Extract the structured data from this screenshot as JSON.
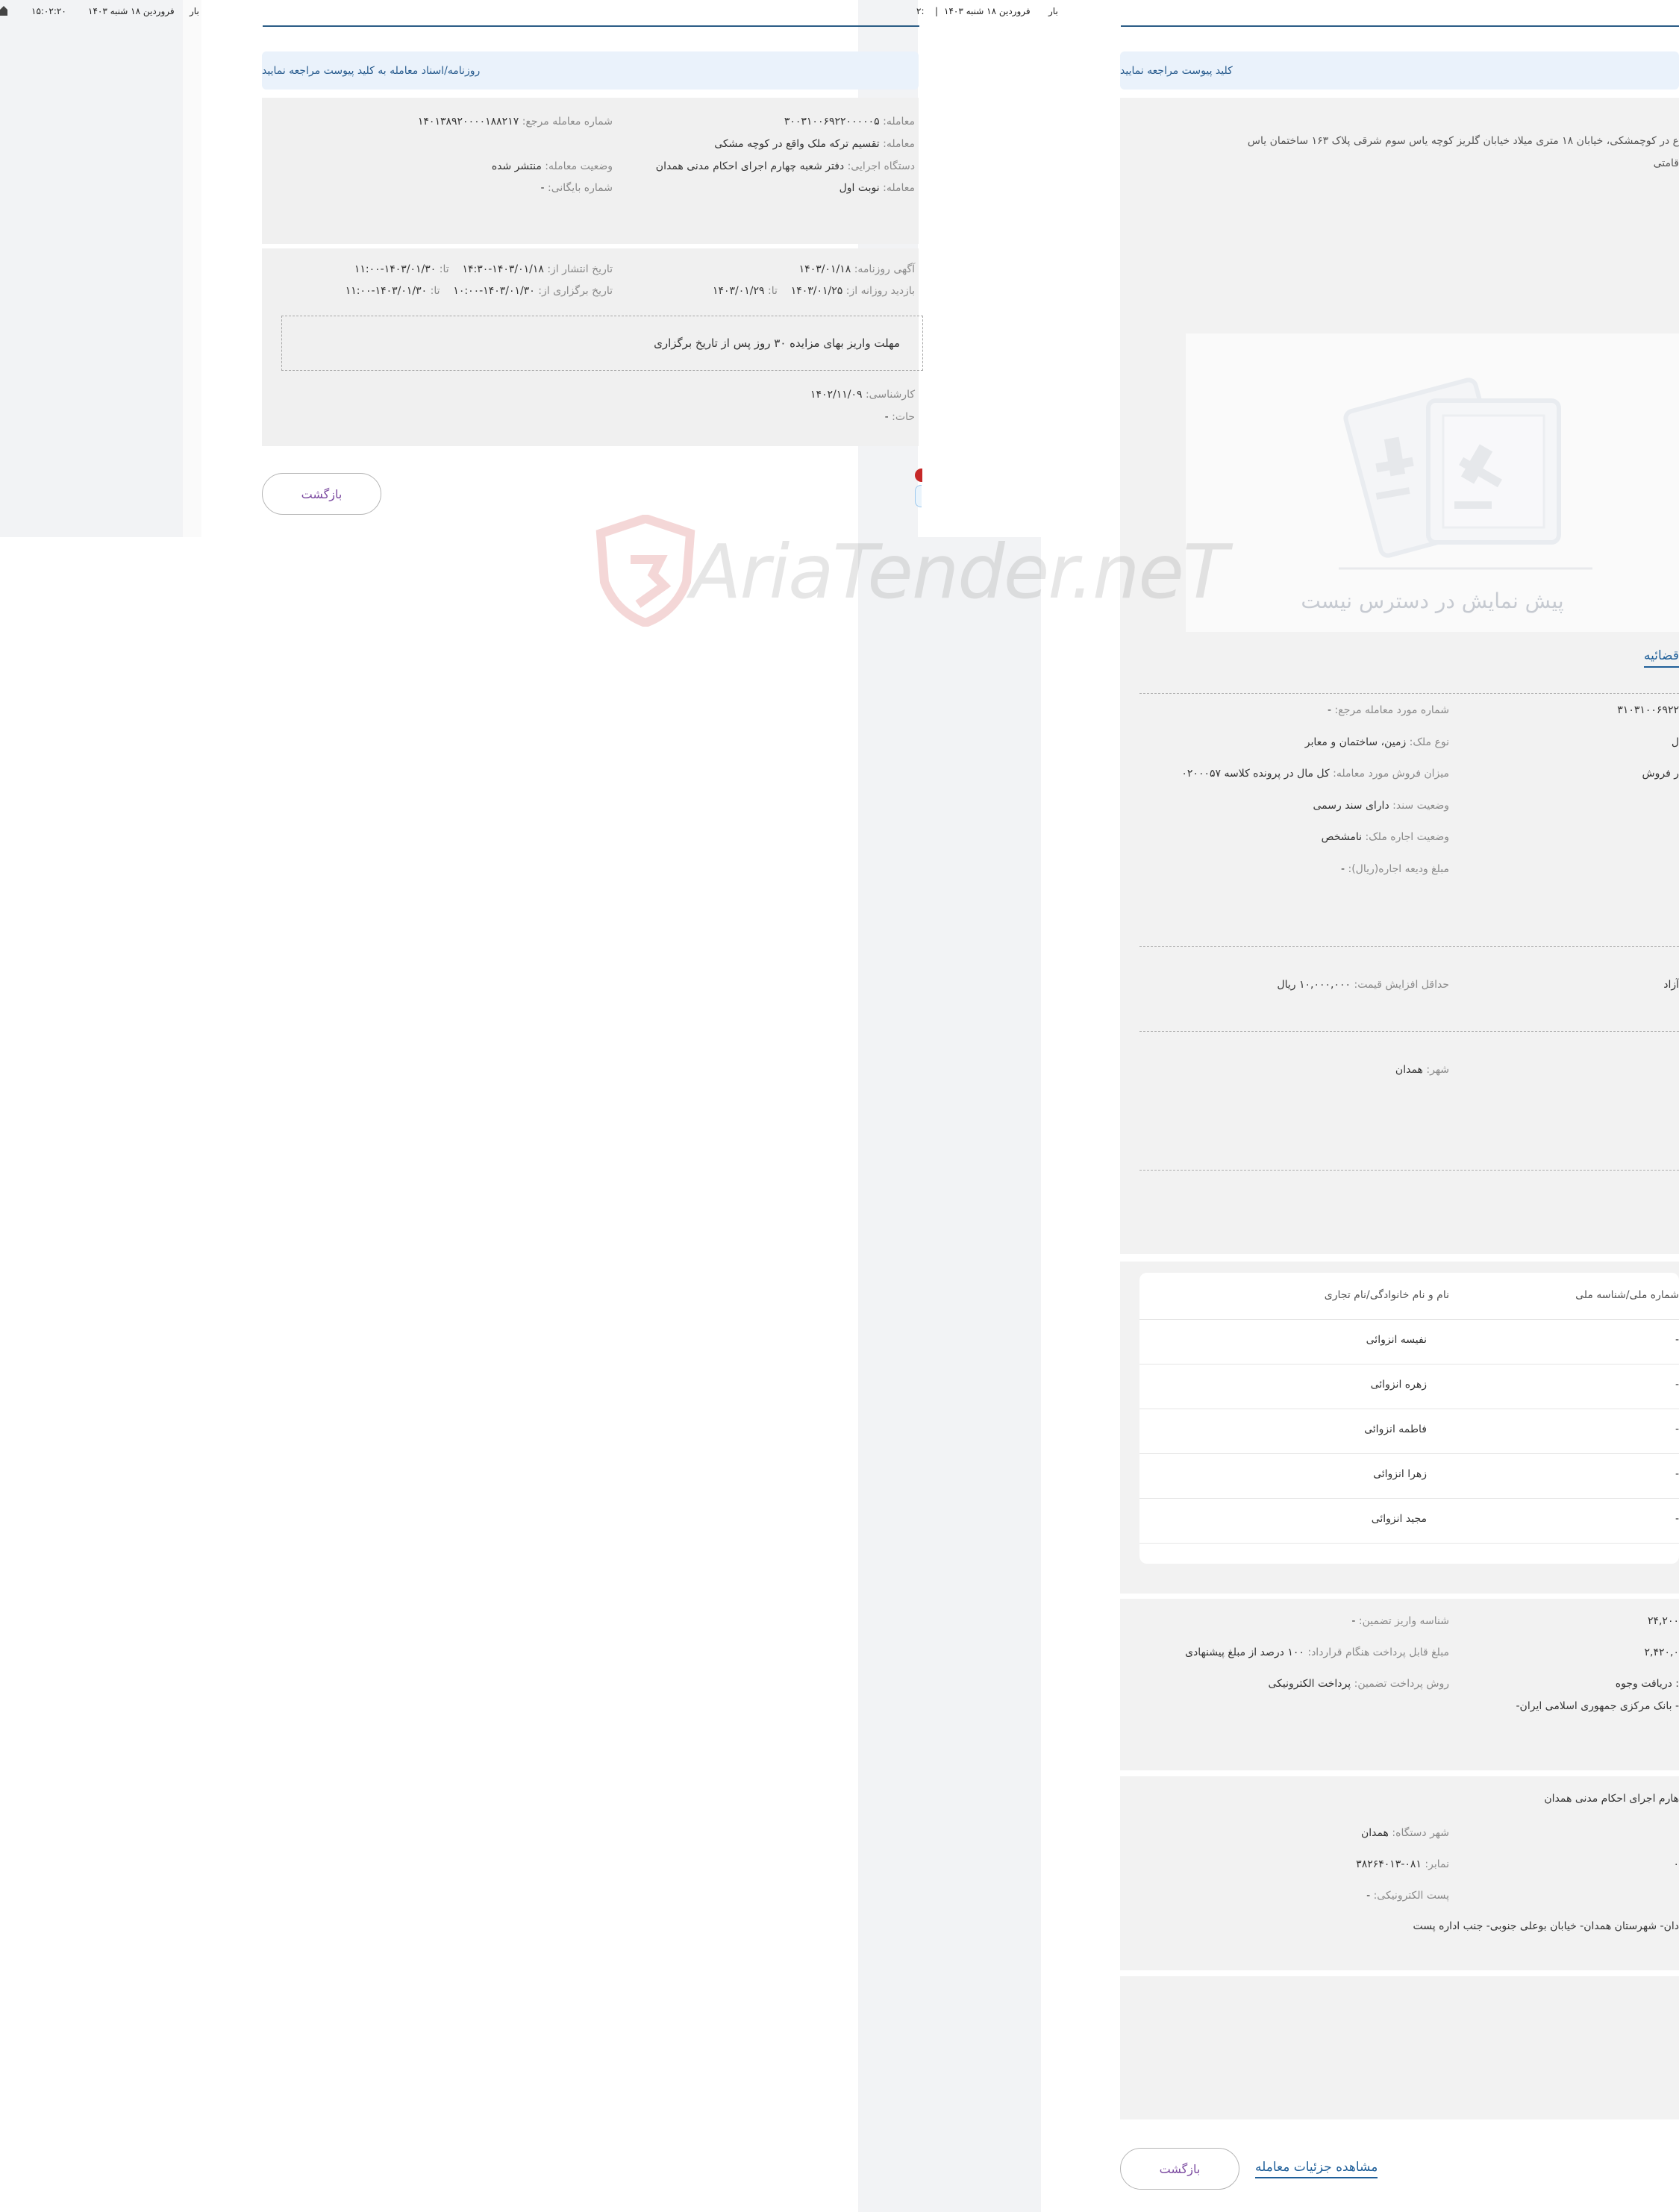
{
  "topbar_left": {
    "date": "فروردین ۱۸ شنبه ۱۴۰۳",
    "time": "۱۵:۰۲:۲۰",
    "cut": "بار"
  },
  "topbar_middle": {
    "date": "فروردین ۱۸ شنبه ۱۴۰۳",
    "sep": "|",
    "cut": "۲:",
    "cut2": "بار"
  },
  "notice_left": "روزنامه/اسناد معامله به کلید پیوست مراجعه نمایید",
  "notice_right": "کلید پیوست مراجعه نمایید",
  "deal_info": {
    "number_label": "معامله:",
    "number_value": "۳۰۰۳۱۰۰۶۹۲۲۰۰۰۰۰۵",
    "ref_label": "شماره معامله مرجع:",
    "ref_value": "۱۴۰۱۳۸۹۲۰۰۰۰۱۸۸۲۱۷",
    "subject_label": "معامله:",
    "subject_value": "تقسیم ترکه ملک واقع در کوچه مشکی",
    "agency_label": "دستگاه اجرایی:",
    "agency_value": "دفتر شعبه چهارم اجرای احکام مدنی همدان",
    "status_label": "وضعیت معامله:",
    "status_value": "منتشر شده",
    "stage_label": "معامله:",
    "stage_value": "نوبت اول",
    "archive_label": "شماره بایگانی:",
    "archive_value": "-"
  },
  "dates": {
    "ad_label": "آگهی روزنامه:",
    "ad_value": "۱۴۰۳/۰۱/۱۸",
    "publish_label": "تاریخ انتشار از:",
    "publish_from": "۱۴۰۳/۰۱/۱۸-۱۴:۳۰",
    "to_label": "تا:",
    "publish_to": "۱۴۰۳/۰۱/۳۰-۱۱:۰۰",
    "visit_label": "بازدید روزانه از:",
    "visit_from": "۱۴۰۳/۰۱/۲۵",
    "visit_to": "۱۴۰۳/۰۱/۲۹",
    "hold_label": "تاریخ برگزاری از:",
    "hold_from": "۱۴۰۳/۰۱/۳۰-۱۰:۰۰",
    "hold_to": "۱۴۰۳/۰۱/۳۰-۱۱:۰۰"
  },
  "deposit_note": "مهلت واریز بهای مزایده ۳۰ روز پس از تاریخ برگزاری",
  "expert": {
    "label": "کارشناسی:",
    "value": "۱۴۰۲/۱۱/۰۹",
    "desc_label": "حات:",
    "desc_value": "-"
  },
  "back_label": "بازگشت",
  "address_text": {
    "line1": "ع در کوچمشکی، خیابان ۱۸ متری میلاد خیابان گلریز کوچه یاس سوم شرقی پلاک ۱۶۳ ساختمان یاس",
    "line2": "قامتی"
  },
  "preview": {
    "text": "پیش نمایش در دسترس نیست"
  },
  "property_title": "قضائیه",
  "property": {
    "item_ref_label": "شماره مورد معامله مرجع:",
    "item_ref_value": "-",
    "item_no_cut": "۳۱۰۳۱۰۰۶۹۲۲",
    "type_label": "نوع ملک:",
    "type_value": "زمین، ساختمان و معابر",
    "type_cut": "ل",
    "share_label": "میزان فروش مورد معامله:",
    "share_value": "کل مال در پرونده کلاسه ۰۲۰۰۰۵۷",
    "share_cut": "ر فروش",
    "doc_label": "وضعیت سند:",
    "doc_value": "دارای سند رسمی",
    "rent_label": "وضعیت اجاره ملک:",
    "rent_value": "نامشخص",
    "deposit_label": "مبلغ ودیعه اجاره(ریال):",
    "deposit_value": "-"
  },
  "price": {
    "min_inc_label": "حداقل افزایش قیمت:",
    "min_inc_value": "۱۰,۰۰۰,۰۰۰ ریال",
    "cut": "آزاد"
  },
  "location": {
    "city_label": "شهر:",
    "city_value": "همدان"
  },
  "owners": {
    "headers": [
      "شماره ملی/شناسه ملی",
      "نام و نام خانوادگی/نام تجاری"
    ],
    "rows": [
      {
        "id": "-",
        "name": "نفیسه انزوائی"
      },
      {
        "id": "-",
        "name": "زهره انزوائی"
      },
      {
        "id": "-",
        "name": "فاطمه انزوائی"
      },
      {
        "id": "-",
        "name": "زهرا انزوائی"
      },
      {
        "id": "-",
        "name": "مجید انزوائی"
      }
    ]
  },
  "payment": {
    "guarantee_id_label": "شناسه واریز تضمین:",
    "guarantee_id_value": "-",
    "contract_label": "مبلغ قابل پرداخت هنگام قرارداد:",
    "contract_value": "۱۰۰ درصد از مبلغ پیشنهادی",
    "method_label": "روش پرداخت تضمین:",
    "method_value": "پرداخت الکترونیکی",
    "cut1": "۲۴,۲۰۰",
    "cut2": "۲,۴۲۰,۰",
    "cut3": ": دریافت وجوه",
    "cut4": "- بانک مرکزی جمهوری اسلامی ایران-"
  },
  "contact": {
    "title_cut": "هارم اجرای احکام مدنی همدان",
    "city_label": "شهر دستگاه:",
    "city_value": "همدان",
    "fax_label": "نمابر:",
    "fax_value": "۰۸۱-۳۸۲۶۴۰۱۳",
    "fax_cut": "۰",
    "email_label": "پست الکترونیکی:",
    "email_value": "-",
    "address_value": "دان- شهرستان همدان- خیابان بوعلی جنوبی- جنب اداره پست"
  },
  "view_details": "مشاهده جزئیات معامله",
  "watermark_text": "AriaTender.neT",
  "colors": {
    "accent_blue": "#2c5d86",
    "notice_bg": "#eaf2fb",
    "card_bg": "#f0f0f0",
    "back_text": "#7b4aa0",
    "link_blue": "#1f5f99"
  }
}
